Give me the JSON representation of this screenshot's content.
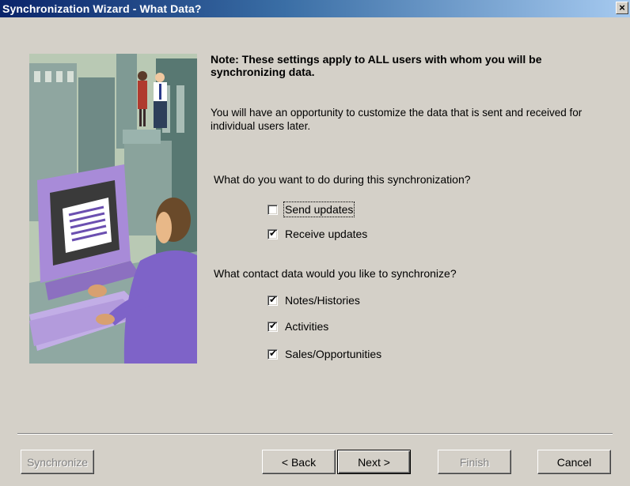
{
  "window": {
    "title": "Synchronization Wizard - What Data?",
    "close_glyph": "×"
  },
  "note": {
    "title": "Note: These settings apply to ALL users with whom you will be synchronizing data.",
    "body": "You will have an opportunity to customize the data that is sent and received for individual users later."
  },
  "sync_section": {
    "question": "What do you want to do during this synchronization?",
    "options": [
      {
        "label": "Send updates",
        "checked": false
      },
      {
        "label": "Receive updates",
        "checked": true
      }
    ]
  },
  "contact_section": {
    "question": "What contact data would you like to synchronize?",
    "options": [
      {
        "label": "Notes/Histories",
        "checked": true
      },
      {
        "label": "Activities",
        "checked": true
      },
      {
        "label": "Sales/Opportunities",
        "checked": true
      }
    ]
  },
  "buttons": {
    "synchronize": "Synchronize",
    "back": "< Back",
    "next": "Next >",
    "finish": "Finish",
    "cancel": "Cancel"
  },
  "colors": {
    "dialog_bg": "#d4d0c8",
    "title_bar_start": "#0a246a",
    "title_bar_end": "#a6caf0",
    "monitor_purple": "#a88bd8"
  },
  "icons": {
    "check": "✔",
    "close": "close-icon"
  }
}
